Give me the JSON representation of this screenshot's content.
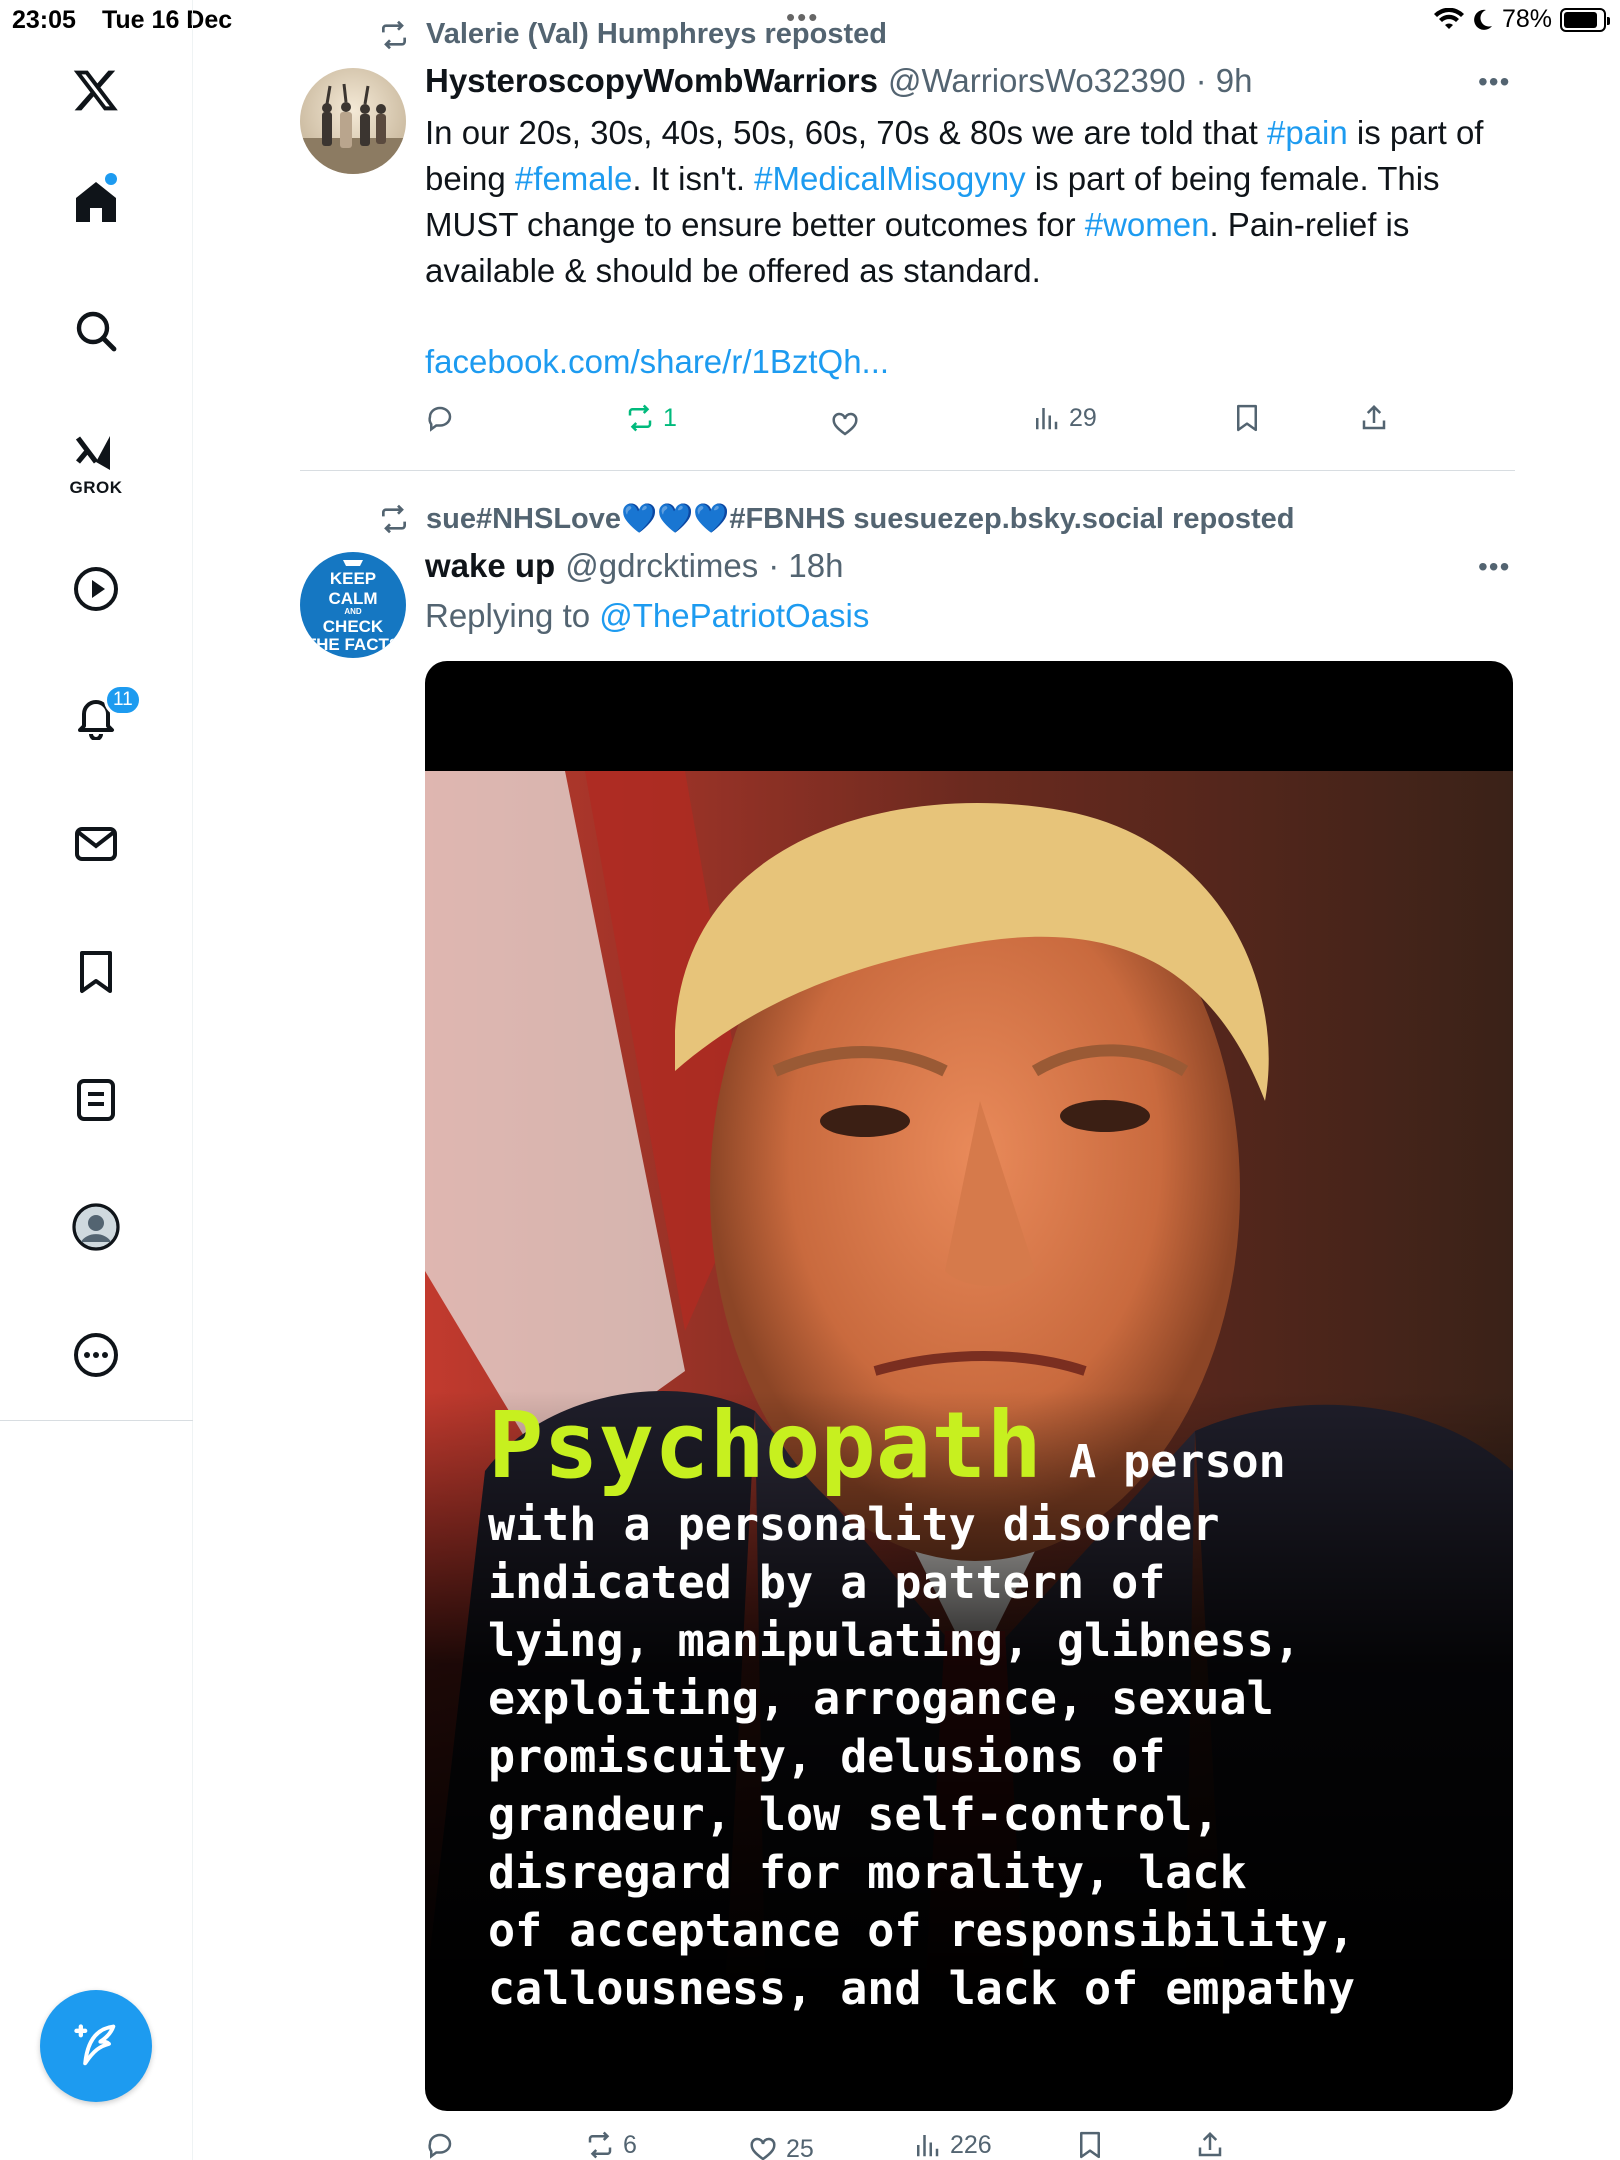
{
  "status_bar": {
    "time": "23:05",
    "date": "Tue 16 Dec",
    "battery": "78%",
    "battery_level": 0.78
  },
  "sidebar": {
    "logo_icon": "x-logo-icon",
    "items": [
      {
        "name": "home",
        "icon": "home-icon"
      },
      {
        "name": "explore",
        "icon": "search-icon"
      },
      {
        "name": "grok",
        "icon": "grok-icon",
        "label": "GROK"
      },
      {
        "name": "videos",
        "icon": "play-icon"
      },
      {
        "name": "notifications",
        "icon": "bell-icon",
        "badge": "11"
      },
      {
        "name": "messages",
        "icon": "mail-icon"
      },
      {
        "name": "bookmarks",
        "icon": "bookmark-icon"
      },
      {
        "name": "lists",
        "icon": "list-icon"
      },
      {
        "name": "profile",
        "icon": "avatar-icon"
      },
      {
        "name": "more",
        "icon": "more-circle-icon"
      }
    ],
    "compose_icon": "compose-icon"
  },
  "colors": {
    "accent": "#1d9bf0",
    "secondary_text": "#536471",
    "repost_green": "#00ba7c",
    "psychopath_green": "#c7f01f"
  },
  "feed": {
    "tweet1": {
      "repost_by": "Valerie (Val) Humphreys reposted",
      "display_name": "HysteroscopyWombWarriors",
      "handle": "@WarriorsWo32390",
      "time": "· 9h",
      "text_parts": [
        {
          "t": "In our 20s, 30s, 40s, 50s, 60s, 70s & 80s we are told that "
        },
        {
          "t": "#pain",
          "tag": true
        },
        {
          "t": " is part of being "
        },
        {
          "t": "#female",
          "tag": true
        },
        {
          "t": ". It isn't. "
        },
        {
          "t": "#MedicalMisogyny",
          "tag": true
        },
        {
          "t": " is part of being female. This MUST change to ensure better outcomes for "
        },
        {
          "t": "#women",
          "tag": true
        },
        {
          "t": ". Pain-relief is available & should be offered as standard."
        }
      ],
      "link": "facebook.com/share/r/1BztQh...",
      "actions": {
        "replies": "",
        "reposts": "1",
        "likes": "",
        "views": "29"
      }
    },
    "tweet2": {
      "repost_by": "sue#NHSLove💙💙💙#FBNHS suesuezep.bsky.social reposted",
      "display_name": "wake up",
      "handle": "@gdrcktimes",
      "time": "· 18h",
      "replying_label": "Replying to ",
      "replying_to": "@ThePatriotOasis",
      "avatar_text": "KEEP CALM AND CHECK THE FACTS",
      "media": {
        "word": "Psychopath",
        "lead": " A person",
        "body": "with a personality disorder\nindicated by a pattern of\nlying, manipulating, glibness,\nexploiting, arrogance, sexual\npromiscuity, delusions of\ngrandeur, low self-control,\ndisregard for morality, lack\nof acceptance of responsibility,\ncallousness, and lack of empathy"
      },
      "actions": {
        "replies": "",
        "reposts": "6",
        "likes": "25",
        "views": "226"
      }
    }
  }
}
